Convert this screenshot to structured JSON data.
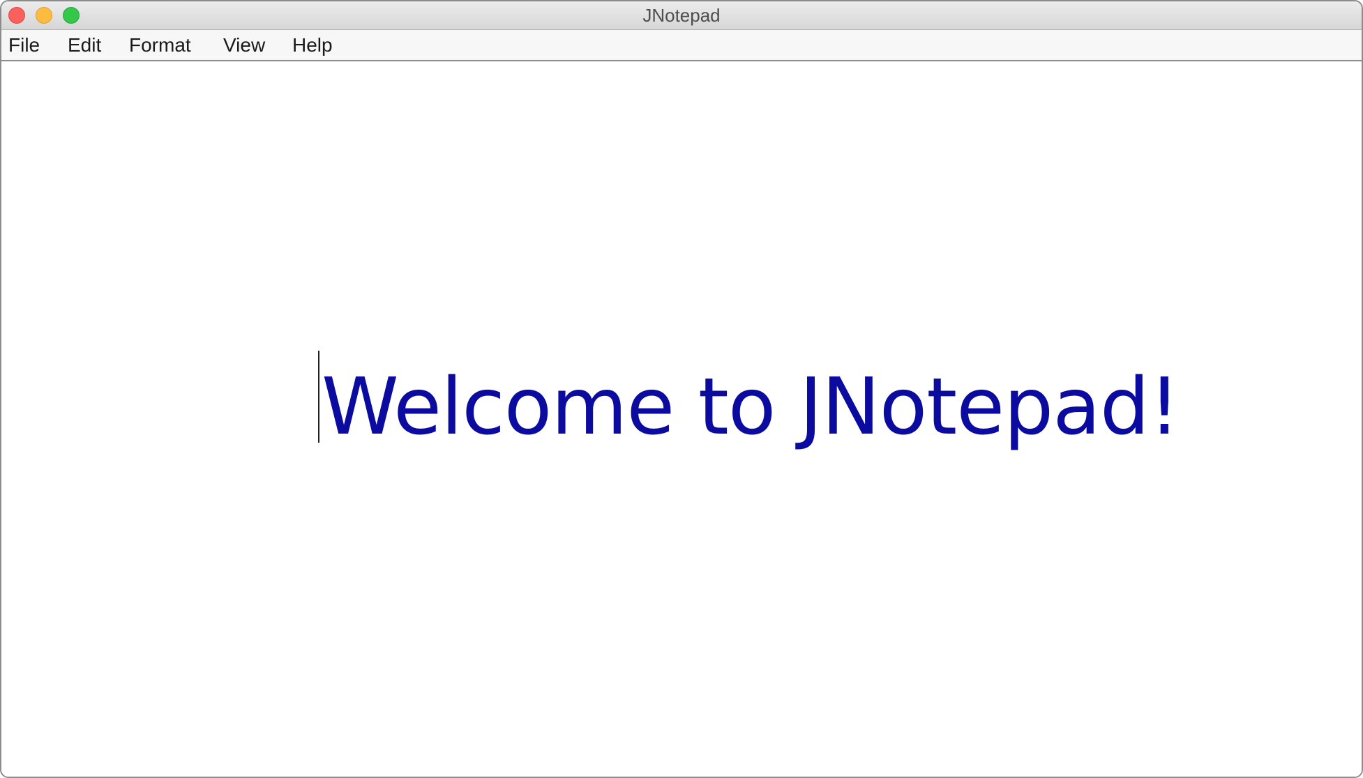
{
  "window": {
    "title": "JNotepad"
  },
  "menubar": {
    "items": [
      {
        "label": "File"
      },
      {
        "label": "Edit"
      },
      {
        "label": "Format"
      },
      {
        "label": "View"
      },
      {
        "label": "Help"
      }
    ]
  },
  "editor": {
    "text": "Welcome to JNotepad!",
    "text_color": "#0b0ba0"
  },
  "colors": {
    "close": "#fc605c",
    "minimize": "#fdbc40",
    "zoom": "#34c84a"
  }
}
